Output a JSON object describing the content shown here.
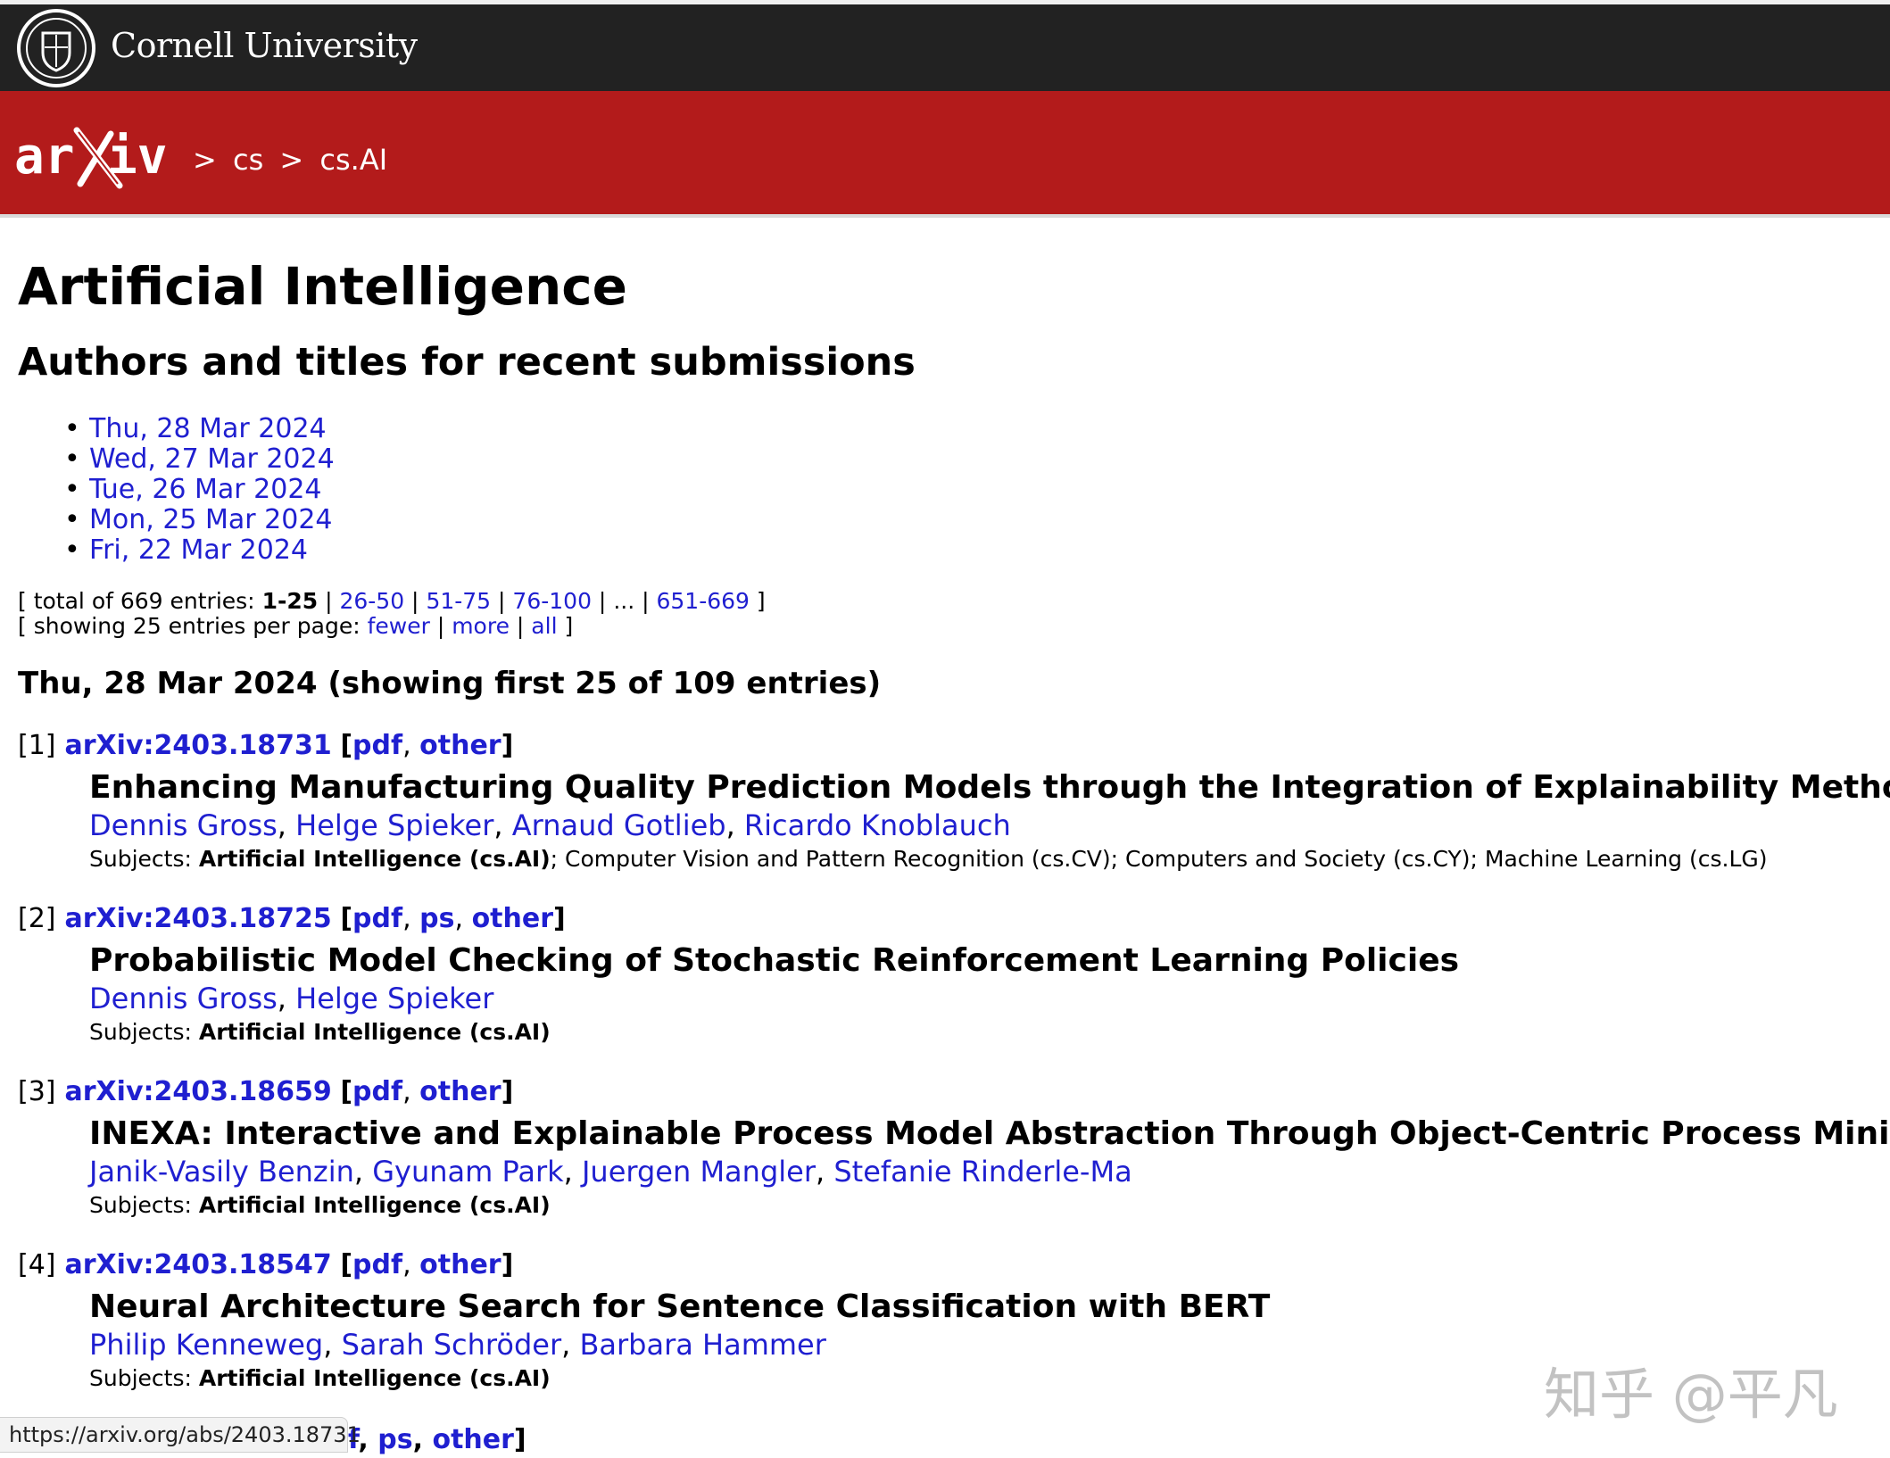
{
  "header": {
    "institution": "Cornell University",
    "breadcrumb": [
      ">",
      "cs",
      ">",
      "cs.AI"
    ]
  },
  "page": {
    "title": "Artificial Intelligence",
    "subtitle": "Authors and titles for recent submissions"
  },
  "dates": [
    "Thu, 28 Mar 2024",
    "Wed, 27 Mar 2024",
    "Tue, 26 Mar 2024",
    "Mon, 25 Mar 2024",
    "Fri, 22 Mar 2024"
  ],
  "paging": {
    "total_prefix": "[ total of 669 entries: ",
    "current": "1-25",
    "pages": [
      "26-50",
      "51-75",
      "76-100"
    ],
    "ellipsis": "...",
    "last": "651-669",
    "per_page_prefix": "[ showing 25 entries per page: ",
    "fewer": "fewer",
    "more": "more",
    "all": "all"
  },
  "day_heading": "Thu, 28 Mar 2024 (showing first 25 of 109 entries)",
  "entries": [
    {
      "num": "[1]",
      "id": "arXiv:2403.18731",
      "formats": [
        "pdf",
        "other"
      ],
      "title": "Enhancing Manufacturing Quality Prediction Models through the Integration of Explainability Methods",
      "authors": [
        "Dennis Gross",
        "Helge Spieker",
        "Arnaud Gotlieb",
        "Ricardo Knoblauch"
      ],
      "subjects_label": "Subjects: ",
      "primary_subject": "Artificial Intelligence (cs.AI)",
      "other_subjects": "; Computer Vision and Pattern Recognition (cs.CV); Computers and Society (cs.CY); Machine Learning (cs.LG)"
    },
    {
      "num": "[2]",
      "id": "arXiv:2403.18725",
      "formats": [
        "pdf",
        "ps",
        "other"
      ],
      "title": "Probabilistic Model Checking of Stochastic Reinforcement Learning Policies",
      "authors": [
        "Dennis Gross",
        "Helge Spieker"
      ],
      "subjects_label": "Subjects: ",
      "primary_subject": "Artificial Intelligence (cs.AI)",
      "other_subjects": ""
    },
    {
      "num": "[3]",
      "id": "arXiv:2403.18659",
      "formats": [
        "pdf",
        "other"
      ],
      "title": "INEXA: Interactive and Explainable Process Model Abstraction Through Object-Centric Process Mining",
      "authors": [
        "Janik-Vasily Benzin",
        "Gyunam Park",
        "Juergen Mangler",
        "Stefanie Rinderle-Ma"
      ],
      "subjects_label": "Subjects: ",
      "primary_subject": "Artificial Intelligence (cs.AI)",
      "other_subjects": ""
    },
    {
      "num": "[4]",
      "id": "arXiv:2403.18547",
      "formats": [
        "pdf",
        "other"
      ],
      "title": "Neural Architecture Search for Sentence Classification with BERT",
      "authors": [
        "Philip Kenneweg",
        "Sarah Schröder",
        "Barbara Hammer"
      ],
      "subjects_label": "Subjects: ",
      "primary_subject": "Artificial Intelligence (cs.AI)",
      "other_subjects": ""
    }
  ],
  "partial_entry": {
    "formats_visible": [
      "f",
      "ps",
      "other"
    ]
  },
  "status_url": "https://arxiv.org/abs/2403.18731",
  "watermark": "知乎 @平凡"
}
